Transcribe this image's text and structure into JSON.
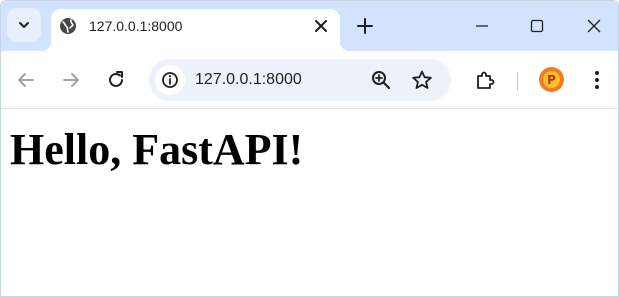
{
  "browser": {
    "tab": {
      "title": "127.0.0.1:8000"
    },
    "omnibox": {
      "url": "127.0.0.1:8000"
    },
    "profile": {
      "initial": "P"
    },
    "colors": {
      "tabstrip": "#d3e3fd",
      "omnibox": "#edf2fa",
      "accent": "#f47b20"
    },
    "icons": [
      "tab-search-icon",
      "globe-icon",
      "close-icon",
      "new-tab-icon",
      "minimize-icon",
      "maximize-icon",
      "window-close-icon",
      "back-icon",
      "forward-icon",
      "reload-icon",
      "info-icon",
      "zoom-icon",
      "star-icon",
      "extensions-icon",
      "menu-icon"
    ]
  },
  "page": {
    "heading": "Hello, FastAPI!"
  }
}
